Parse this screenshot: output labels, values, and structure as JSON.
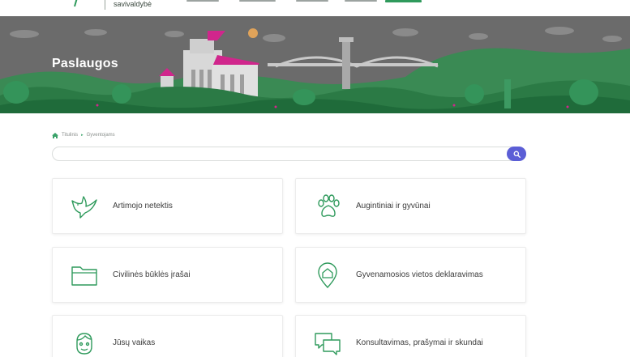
{
  "header": {
    "logo_text": "savivaldybė"
  },
  "hero": {
    "title": "Paslaugos"
  },
  "breadcrumb": {
    "items": [
      "Titulinis",
      "Gyventojams"
    ]
  },
  "search": {
    "placeholder": ""
  },
  "services": [
    {
      "label": "Artimojo netektis",
      "icon": "dove-icon"
    },
    {
      "label": "Augintiniai ir gyvūnai",
      "icon": "paw-icon"
    },
    {
      "label": "Civilinės būklės įrašai",
      "icon": "folder-icon"
    },
    {
      "label": "Gyvenamosios vietos deklaravimas",
      "icon": "location-home-icon"
    },
    {
      "label": "Jūsų vaikas",
      "icon": "child-face-icon"
    },
    {
      "label": "Konsultavimas, prašymai ir skundai",
      "icon": "chat-bubbles-icon"
    }
  ],
  "colors": {
    "accent_green": "#2f9a5c",
    "search_button": "#5b5ed6",
    "hero_magenta": "#d0268c"
  }
}
